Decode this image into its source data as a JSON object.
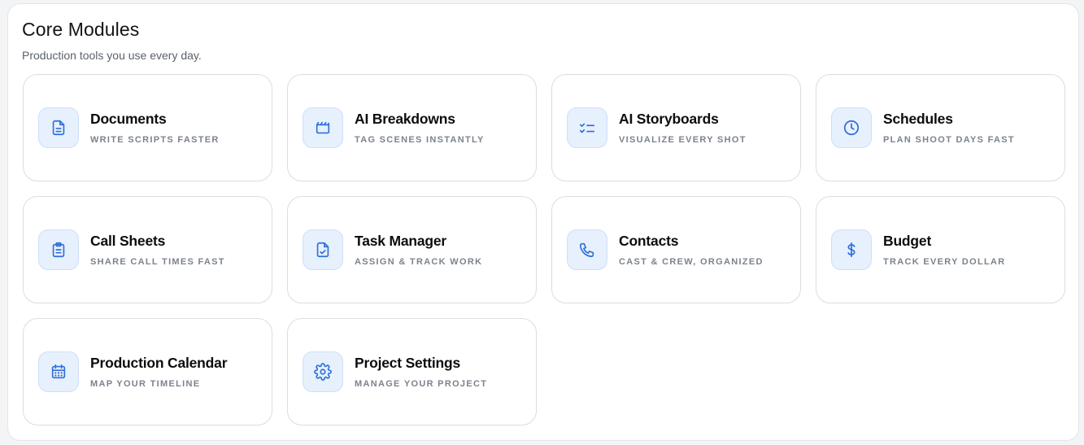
{
  "header": {
    "title": "Core Modules",
    "subtitle": "Production tools you use every day."
  },
  "colors": {
    "accent": "#2f6fd8",
    "icon_bg": "#e7f0fd"
  },
  "modules": [
    {
      "title": "Documents",
      "subtitle": "WRITE SCRIPTS FASTER",
      "icon": "document-icon"
    },
    {
      "title": "AI Breakdowns",
      "subtitle": "TAG SCENES INSTANTLY",
      "icon": "clapperboard-icon"
    },
    {
      "title": "AI Storyboards",
      "subtitle": "VISUALIZE EVERY SHOT",
      "icon": "checklist-icon"
    },
    {
      "title": "Schedules",
      "subtitle": "PLAN SHOOT DAYS FAST",
      "icon": "clock-icon"
    },
    {
      "title": "Call Sheets",
      "subtitle": "SHARE CALL TIMES FAST",
      "icon": "clipboard-icon"
    },
    {
      "title": "Task Manager",
      "subtitle": "ASSIGN & TRACK WORK",
      "icon": "file-check-icon"
    },
    {
      "title": "Contacts",
      "subtitle": "CAST & CREW, ORGANIZED",
      "icon": "phone-icon"
    },
    {
      "title": "Budget",
      "subtitle": "TRACK EVERY DOLLAR",
      "icon": "dollar-icon"
    },
    {
      "title": "Production Calendar",
      "subtitle": "MAP YOUR TIMELINE",
      "icon": "calendar-icon"
    },
    {
      "title": "Project Settings",
      "subtitle": "MANAGE YOUR PROJECT",
      "icon": "gear-icon"
    }
  ]
}
